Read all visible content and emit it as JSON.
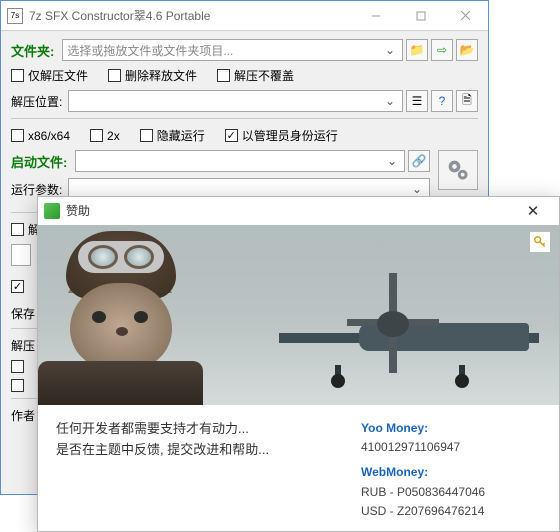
{
  "window": {
    "title": "7z SFX Constructor翠4.6 Portable",
    "app_icon_text": "7s"
  },
  "main": {
    "folder_label": "文件夹:",
    "folder_placeholder": "选择或拖放文件或文件夹项目...",
    "chk_extract_only": "仅解压文件",
    "chk_delete_after": "删除释放文件",
    "chk_no_overwrite": "解压不覆盖",
    "extract_loc_label": "解压位置:",
    "chk_x86x64": "x86/x64",
    "chk_2x": "2x",
    "chk_hidden": "隐藏运行",
    "chk_admin": "以管理员身份运行",
    "start_file_label": "启动文件:",
    "run_params_label": "运行参数:",
    "row_a_label": "解",
    "row_b_label": "保存",
    "row_c_label": "解压",
    "author_label": "作者"
  },
  "dialog": {
    "title": "赞助",
    "text_line1": "任何开发者都需要支持才有动力...",
    "text_line2": "是否在主题中反馈, 提交改进和帮助...",
    "pm1_label": "Yoo Money:",
    "pm1_value": "410012971106947",
    "pm2_label": "WebMoney:",
    "pm2_rub": "P050836447046",
    "pm2_usd": "Z207696476214",
    "rub_prefix": "RUB  -  ",
    "usd_prefix": "USD  -  "
  }
}
